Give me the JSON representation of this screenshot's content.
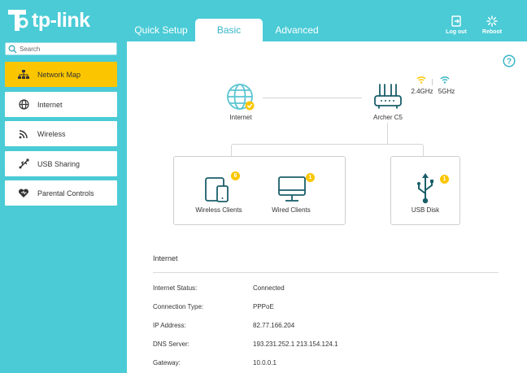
{
  "brand": {
    "name": "tp-link"
  },
  "tabs": [
    {
      "label": "Quick Setup",
      "active": false
    },
    {
      "label": "Basic",
      "active": true
    },
    {
      "label": "Advanced",
      "active": false
    }
  ],
  "header": {
    "logout_label": "Log out",
    "reboot_label": "Reboot"
  },
  "search": {
    "placeholder": "Search"
  },
  "sidebar": {
    "items": [
      {
        "label": "Network Map",
        "icon": "network-map-icon",
        "active": true
      },
      {
        "label": "Internet",
        "icon": "globe-icon",
        "active": false
      },
      {
        "label": "Wireless",
        "icon": "wifi-icon",
        "active": false
      },
      {
        "label": "USB Sharing",
        "icon": "usb-icon",
        "active": false
      },
      {
        "label": "Parental Controls",
        "icon": "heart-icon",
        "active": false
      }
    ]
  },
  "map": {
    "internet_label": "Internet",
    "router_label": "Archer C5",
    "band_24": "2.4GHz",
    "band_5": "5GHz",
    "wireless_clients": {
      "label": "Wireless Clients",
      "count": "6"
    },
    "wired_clients": {
      "label": "Wired Clients",
      "count": "1"
    },
    "usb_disk": {
      "label": "USB Disk",
      "count": "1"
    }
  },
  "internet_info": {
    "title": "Internet",
    "rows": [
      {
        "label": "Internet Status:",
        "value": "Connected"
      },
      {
        "label": "Connection Type:",
        "value": "PPPoE"
      },
      {
        "label": "IP Address:",
        "value": "82.77.166.204"
      },
      {
        "label": "DNS Server:",
        "value": "193.231.252.1 213.154.124.1"
      },
      {
        "label": "Gateway:",
        "value": "10.0.0.1"
      }
    ]
  },
  "colors": {
    "accent": "#4acbd6",
    "active": "#fbc600",
    "icon": "#1a5e6a",
    "globe": "#5cc5d1"
  }
}
